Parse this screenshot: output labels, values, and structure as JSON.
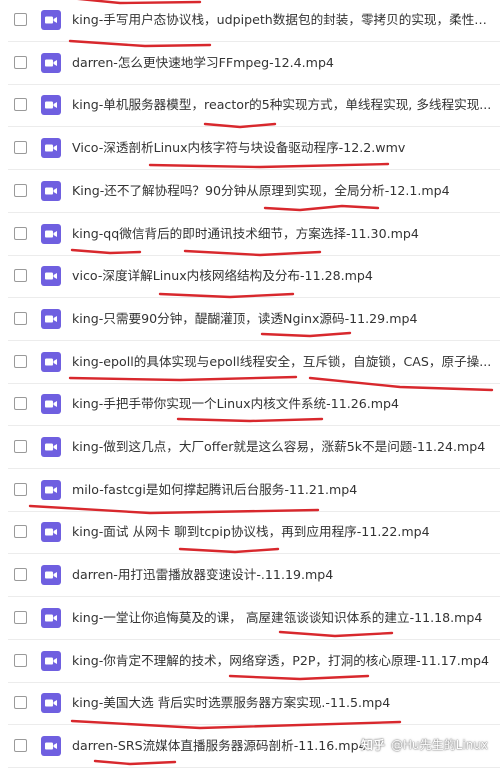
{
  "files": [
    {
      "name": "king-手写用户态协议栈，udpipeth数据包的封装，零拷贝的实现，柔性数组..."
    },
    {
      "name": "darren-怎么更快速地学习FFmpeg-12.4.mp4"
    },
    {
      "name": "king-单机服务器模型，reactor的5种实现方式，单线程实现, 多线程实现..."
    },
    {
      "name": "Vico-深透剖析Linux内核字符与块设备驱动程序-12.2.wmv"
    },
    {
      "name": "King-还不了解协程吗？90分钟从原理到实现，全局分析-12.1.mp4"
    },
    {
      "name": "king-qq微信背后的即时通讯技术细节，方案选择-11.30.mp4"
    },
    {
      "name": "vico-深度详解Linux内核网络结构及分布-11.28.mp4"
    },
    {
      "name": "king-只需要90分钟，醍醐灌顶，读透Nginx源码-11.29.mp4"
    },
    {
      "name": "king-epoll的具体实现与epoll线程安全，互斥锁，自旋锁，CAS，原子操..."
    },
    {
      "name": "king-手把手带你实现一个Linux内核文件系统-11.26.mp4"
    },
    {
      "name": "king-做到这几点，大厂offer就是这么容易，涨薪5k不是问题-11.24.mp4"
    },
    {
      "name": "milo-fastcgi是如何撑起腾讯后台服务-11.21.mp4"
    },
    {
      "name": "king-面试 从网卡 聊到tcpip协议栈，再到应用程序-11.22.mp4"
    },
    {
      "name": "darren-用打迅雷播放器变速设计-.11.19.mp4"
    },
    {
      "name": "king-一堂让你追悔莫及的课，  高屋建瓴谈谈知识体系的建立-11.18.mp4"
    },
    {
      "name": "king-你肯定不理解的技术，网络穿透，P2P，打洞的核心原理-11.17.mp4"
    },
    {
      "name": "king-美国大选 背后实时选票服务器方案实现.-11.5.mp4"
    },
    {
      "name": "darren-SRS流媒体直播服务器源码剖析-11.16.mp4"
    }
  ],
  "watermark": {
    "logo": "知乎",
    "text": "@Hu先生的Linux"
  },
  "colors": {
    "video_icon": "#6f5fe0",
    "underline": "#d8282d"
  }
}
